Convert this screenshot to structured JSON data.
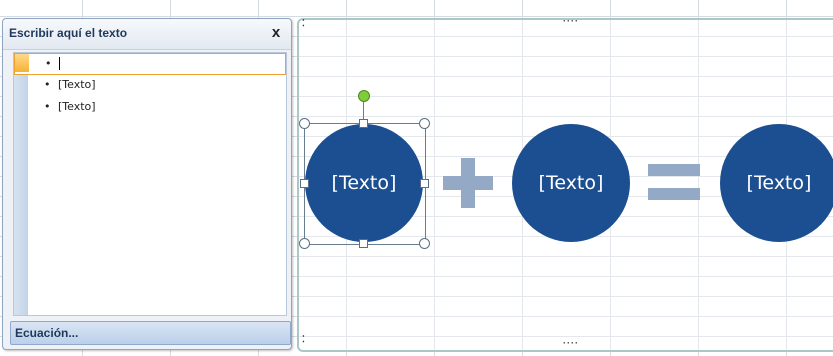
{
  "text_pane": {
    "title": "Escribir aquí el texto",
    "close_label": "x",
    "bullet": "•",
    "items": [
      {
        "text": ""
      },
      {
        "text": "[Texto]"
      },
      {
        "text": "[Texto]"
      }
    ],
    "footer_label": "Ecuación..."
  },
  "diagram": {
    "type": "equation",
    "shapes": [
      {
        "label": "[Texto]"
      },
      {
        "label": "[Texto]"
      },
      {
        "label": "[Texto]"
      }
    ],
    "operators": [
      "plus",
      "equals"
    ],
    "colors": {
      "circle": "#1b4f91",
      "operator": "#94a9c6"
    }
  }
}
